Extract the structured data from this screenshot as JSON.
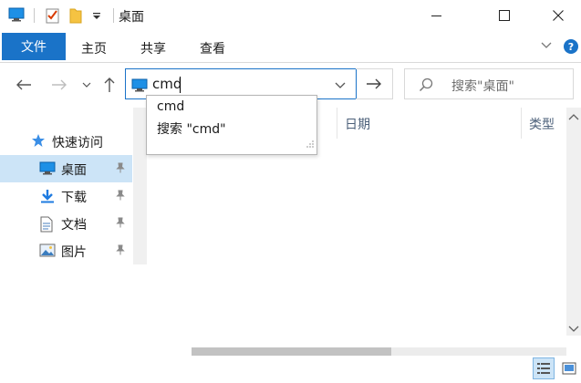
{
  "window": {
    "title": "桌面",
    "controls": {
      "minimize": "minimize-icon",
      "maximize": "maximize-icon",
      "close": "close-icon"
    }
  },
  "quick_access_toolbar": {
    "icons": [
      "monitor-icon",
      "properties-checklist-icon",
      "new-folder-icon",
      "customize-dropdown-icon"
    ]
  },
  "ribbon": {
    "file_tab": "文件",
    "tabs": [
      "主页",
      "共享",
      "查看"
    ],
    "accent": "#1a73c8"
  },
  "address_bar": {
    "value": "cmd",
    "search_placeholder": "搜索\"桌面\""
  },
  "autocomplete": {
    "items": [
      "cmd",
      "搜索 \"cmd\""
    ]
  },
  "nav_pane": {
    "quick_access": "快速访问",
    "items": [
      {
        "label": "桌面",
        "icon": "desktop-icon",
        "selected": true,
        "pinned": true
      },
      {
        "label": "下载",
        "icon": "download-icon",
        "selected": false,
        "pinned": true
      },
      {
        "label": "文档",
        "icon": "document-icon",
        "selected": false,
        "pinned": true
      },
      {
        "label": "图片",
        "icon": "pictures-icon",
        "selected": false,
        "pinned": true
      }
    ]
  },
  "columns": {
    "date": "日期",
    "type": "类型"
  },
  "colors": {
    "selection": "#cce4f7",
    "border": "#d9d9d9",
    "header_text": "#4c607a"
  }
}
